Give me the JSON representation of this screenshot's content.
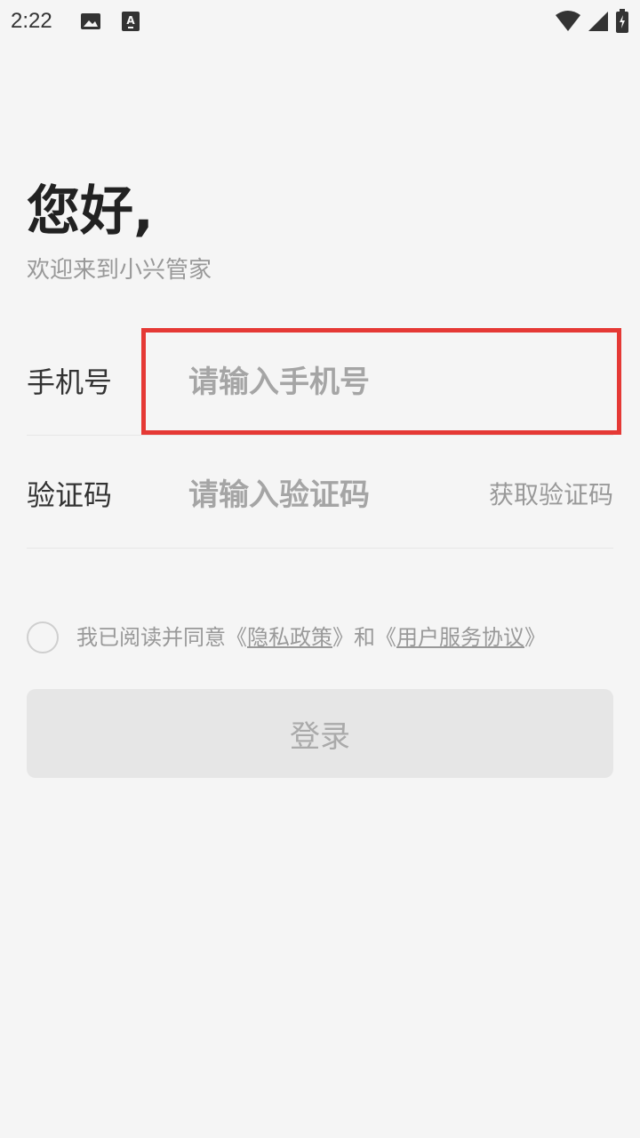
{
  "status_bar": {
    "time": "2:22",
    "left_icons": [
      "image-icon",
      "a-icon"
    ],
    "right_icons": [
      "wifi-icon",
      "signal-icon",
      "battery-icon"
    ]
  },
  "header": {
    "greeting": "您好,",
    "welcome": "欢迎来到小兴管家"
  },
  "form": {
    "phone": {
      "label": "手机号",
      "placeholder": "请输入手机号",
      "value": ""
    },
    "code": {
      "label": "验证码",
      "placeholder": "请输入验证码",
      "value": "",
      "get_code_label": "获取验证码"
    }
  },
  "agreement": {
    "checked": false,
    "prefix": "我已阅读并同意《",
    "privacy": "隐私政策",
    "middle": "》和《",
    "terms": "用户服务协议",
    "suffix": "》"
  },
  "login": {
    "label": "登录"
  },
  "colors": {
    "background": "#f5f5f5",
    "highlight": "#e53935",
    "button_bg": "#e6e6e6",
    "muted_text": "#999999"
  }
}
